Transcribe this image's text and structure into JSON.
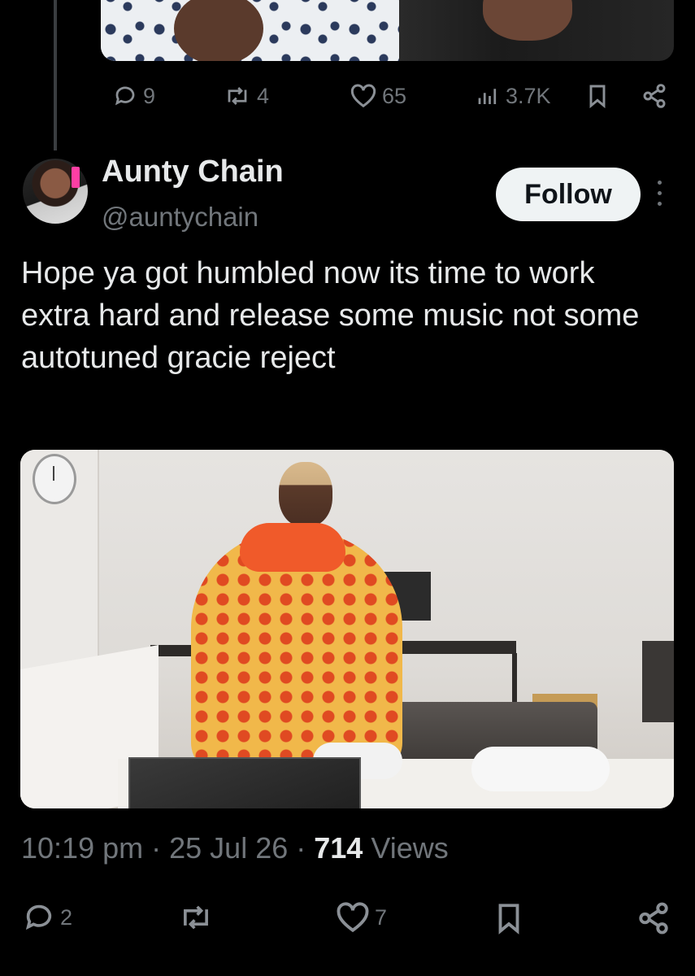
{
  "previous_tweet": {
    "actions": {
      "replies": "9",
      "retweets": "4",
      "likes": "65",
      "views": "3.7K"
    }
  },
  "tweet": {
    "author": {
      "display_name": "Aunty Chain",
      "handle": "@auntychain"
    },
    "follow_label": "Follow",
    "text": "Hope ya got humbled now its time to work extra hard and release some music not some autotuned gracie reject",
    "timestamp": "10:19 pm",
    "date": "25 Jul 26",
    "views_count": "714",
    "views_label": "Views",
    "actions": {
      "replies": "2",
      "retweets": "",
      "likes": "7"
    }
  },
  "icons": [
    "reply-icon",
    "retweet-icon",
    "like-icon",
    "views-icon",
    "bookmark-icon",
    "share-icon",
    "more-icon"
  ],
  "colors": {
    "background": "#000000",
    "text_primary": "#e7e9ea",
    "text_secondary": "#71767b",
    "follow_button_bg": "#eff3f4",
    "follow_button_text": "#0f1419"
  }
}
